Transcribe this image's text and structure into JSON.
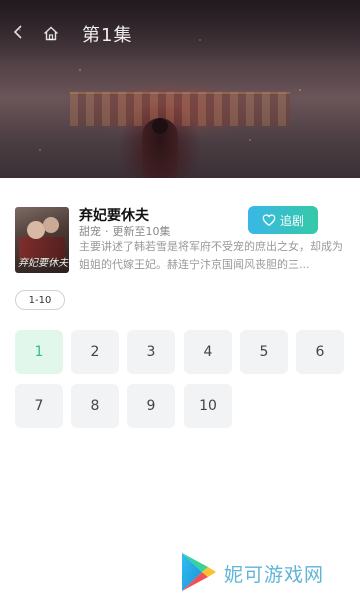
{
  "header": {
    "episode_title": "第1集"
  },
  "drama": {
    "title": "弃妃要休夫",
    "poster_text": "弃妃要休夫",
    "genre": "甜宠",
    "separator": "·",
    "update_status": "更新至10集",
    "description": "主要讲述了韩若雪是将军府不受宠的庶出之女，却成为姐姐的代嫁王妃。赫连宁汴京国闻风丧胆的三...",
    "follow_label": "追剧"
  },
  "range_tabs": [
    {
      "label": "1-10",
      "selected": true
    }
  ],
  "episodes": [
    {
      "label": "1",
      "active": true
    },
    {
      "label": "2",
      "active": false
    },
    {
      "label": "3",
      "active": false
    },
    {
      "label": "4",
      "active": false
    },
    {
      "label": "5",
      "active": false
    },
    {
      "label": "6",
      "active": false
    },
    {
      "label": "7",
      "active": false
    },
    {
      "label": "8",
      "active": false
    },
    {
      "label": "9",
      "active": false
    },
    {
      "label": "10",
      "active": false
    }
  ],
  "watermark": {
    "text": "妮可游戏网"
  },
  "colors": {
    "accent_green": "#2ec27e",
    "follow_gradient_start": "#39b8e6",
    "follow_gradient_end": "#35c9a7",
    "watermark_blue": "#5fb4d8"
  }
}
